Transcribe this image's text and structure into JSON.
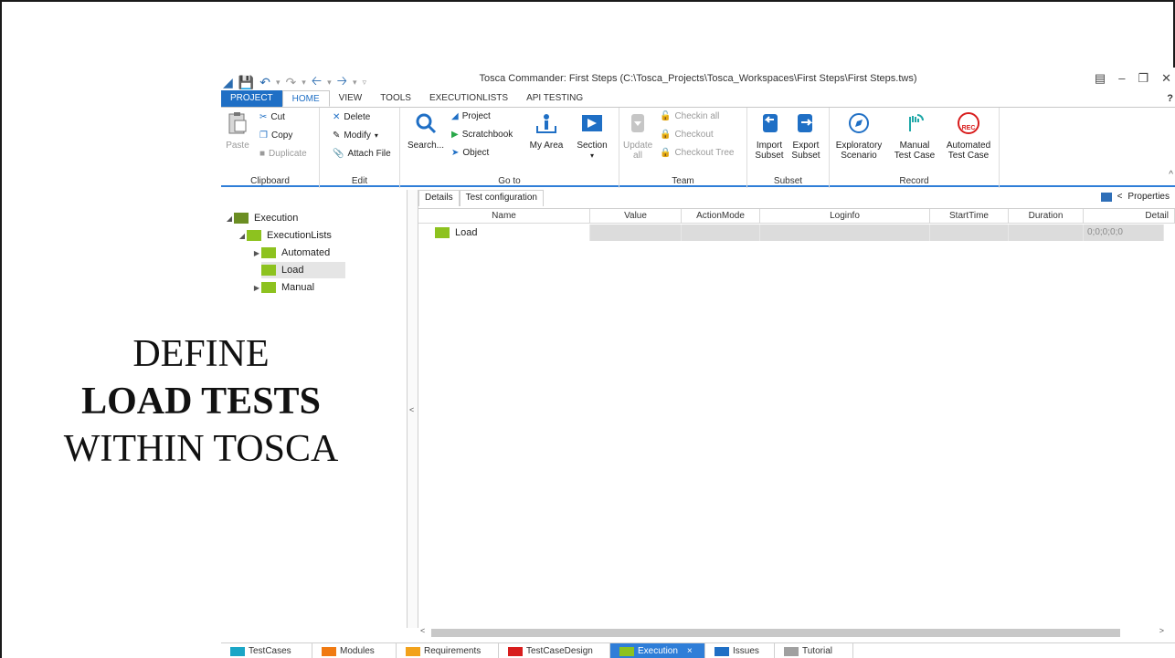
{
  "slide": {
    "line1": "DEFINE",
    "line2": "LOAD TESTS",
    "line3": "WITHIN TOSCA"
  },
  "window": {
    "title": "Tosca Commander: First Steps (C:\\Tosca_Projects\\Tosca_Workspaces\\First Steps\\First Steps.tws)",
    "help": "?"
  },
  "ribbon_tabs": [
    "PROJECT",
    "HOME",
    "VIEW",
    "TOOLS",
    "EXECUTIONLISTS",
    "API TESTING"
  ],
  "ribbon": {
    "clipboard": {
      "label": "Clipboard",
      "paste": "Paste",
      "cut": "Cut",
      "copy": "Copy",
      "duplicate": "Duplicate"
    },
    "edit": {
      "label": "Edit",
      "delete": "Delete",
      "modify": "Modify",
      "attach": "Attach File"
    },
    "goto": {
      "label": "Go to",
      "search": "Search...",
      "project": "Project",
      "scratchbook": "Scratchbook",
      "object": "Object",
      "myarea": "My Area",
      "section": "Section"
    },
    "team": {
      "label": "Team",
      "update": "Update all",
      "checkin": "Checkin all",
      "checkout": "Checkout",
      "checkout_tree": "Checkout Tree"
    },
    "subset": {
      "label": "Subset",
      "import": "Import Subset",
      "export": "Export Subset"
    },
    "record": {
      "label": "Record",
      "exploratory": "Exploratory Scenario",
      "manual": "Manual Test Case",
      "automated": "Automated Test Case",
      "rec_badge": "REC"
    }
  },
  "tree": {
    "root": "Execution",
    "lists": "ExecutionLists",
    "automated": "Automated",
    "load": "Load",
    "manual": "Manual"
  },
  "details": {
    "tab_details": "Details",
    "tab_testconfig": "Test configuration",
    "properties": "Properties",
    "columns": [
      "Name",
      "Value",
      "ActionMode",
      "Loginfo",
      "StartTime",
      "Duration",
      "Detail"
    ],
    "row": {
      "name": "Load",
      "detail": "0;0;0;0;0"
    }
  },
  "bottom_tabs": [
    {
      "label": "TestCases",
      "color": "#1aa6c6"
    },
    {
      "label": "Modules",
      "color": "#f07a12"
    },
    {
      "label": "Requirements",
      "color": "#f2a21b"
    },
    {
      "label": "TestCaseDesign",
      "color": "#d81d1d"
    },
    {
      "label": "Execution",
      "color": "#8dc21f",
      "close": "×"
    },
    {
      "label": "Issues",
      "color": "#1f6fc5"
    },
    {
      "label": "Tutorial",
      "color": "#a0a0a0"
    }
  ]
}
